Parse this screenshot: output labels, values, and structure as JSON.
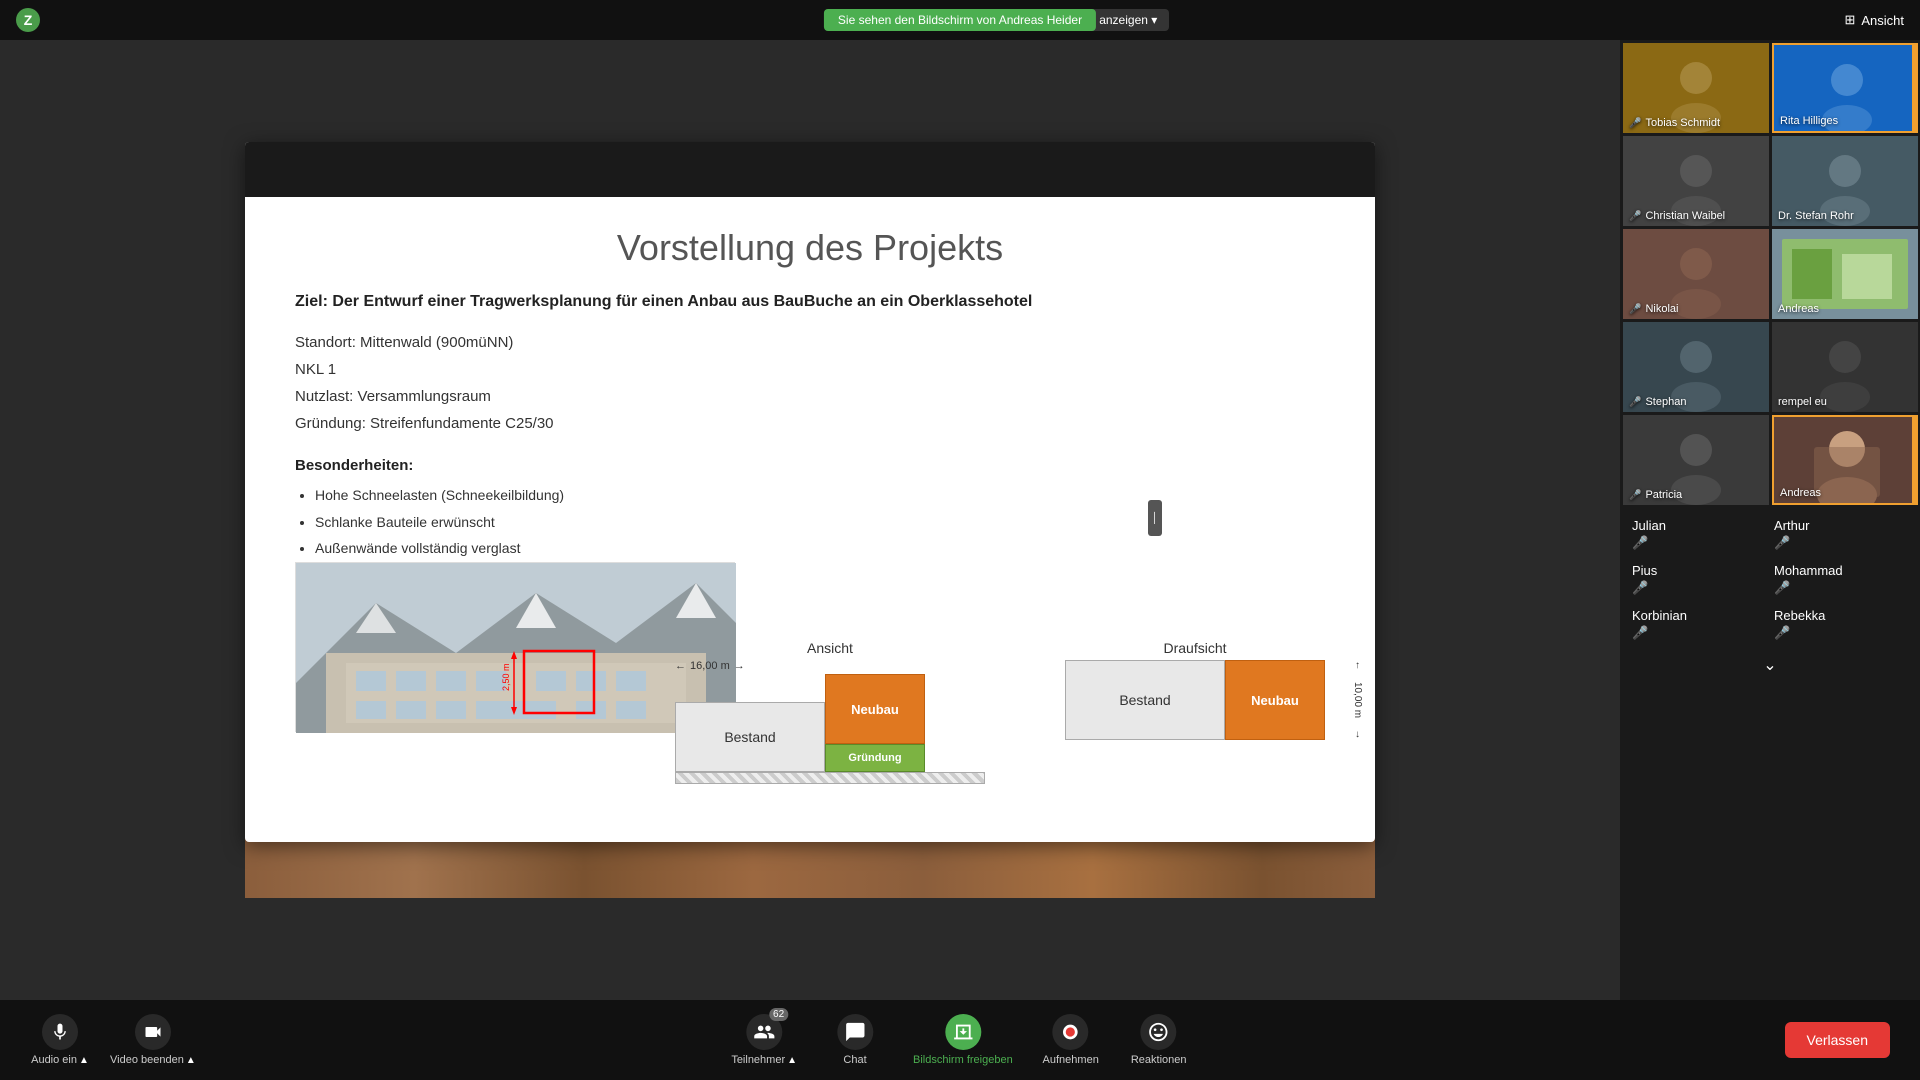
{
  "app": {
    "logo_symbol": "Z",
    "sharing_banner": "Sie sehen den Bildschirm von Andreas Heider",
    "options_btn": "Optionen anzeigen ▾",
    "view_label": "Ansicht",
    "view_icon": "⊞"
  },
  "slide": {
    "title": "Vorstellung des Projekts",
    "ziel": "Ziel: Der Entwurf einer Tragwerksplanung für einen Anbau aus BauBuche an ein Oberklassehotel",
    "details": [
      "Standort: Mittenwald (900müNN)",
      "NKL 1",
      "Nutzlast: Versammlungsraum",
      "Gründung: Streifenfundamente C25/30"
    ],
    "besonderheiten_label": "Besonderheiten:",
    "bullets": [
      "Hohe Schneelasten (Schneekeilbildung)",
      "Schlanke Bauteile erwünscht",
      "Außenwände vollständig verglast"
    ],
    "ansicht_label": "Ansicht",
    "ansicht_measure": "16,00 m",
    "box_bestand": "Bestand",
    "box_neubau": "Neubau",
    "box_grundung": "Gründung",
    "draufsicht_label": "Draufsicht",
    "draufsicht_bestand": "Bestand",
    "draufsicht_neubau": "Neubau",
    "draufsicht_measure": "10,00 m",
    "red_arrow_label": "2,50 m"
  },
  "participants": {
    "video_tiles": [
      {
        "name": "Tobias Schmidt",
        "tile_class": "tile-tobias",
        "mic_off": true
      },
      {
        "name": "Rita Hilliges",
        "tile_class": "tile-rita",
        "mic_off": false,
        "active": true
      },
      {
        "name": "Christian Waibel",
        "tile_class": "tile-christian",
        "mic_off": true
      },
      {
        "name": "Dr. Stefan Rohr",
        "tile_class": "tile-stefan",
        "mic_off": false
      },
      {
        "name": "Nikolai",
        "tile_class": "tile-nikolai",
        "mic_off": true
      },
      {
        "name": "Andreas",
        "tile_class": "tile-andreas1",
        "mic_off": false
      },
      {
        "name": "Stephan",
        "tile_class": "tile-stephan",
        "mic_off": true
      },
      {
        "name": "rempel eu",
        "tile_class": "tile-rempel",
        "mic_off": false
      },
      {
        "name": "Patricia",
        "tile_class": "tile-patricia",
        "mic_off": true
      },
      {
        "name": "Andreas",
        "tile_class": "tile-andreas2",
        "mic_off": false,
        "active": true
      }
    ],
    "audio_only": [
      {
        "name": "Julian",
        "mic_off": true
      },
      {
        "name": "Arthur",
        "mic_off": true
      },
      {
        "name": "Pius",
        "mic_off": true
      },
      {
        "name": "Mohammad",
        "mic_off": true
      },
      {
        "name": "Korbinian",
        "mic_off": true
      },
      {
        "name": "Rebekka",
        "mic_off": true
      }
    ]
  },
  "toolbar": {
    "left": [
      {
        "label": "Audio ein",
        "icon": "🎤",
        "sub_icon": "▲",
        "active": false
      },
      {
        "label": "Video beenden",
        "icon": "📷",
        "sub_icon": "▲",
        "active": false
      }
    ],
    "center": [
      {
        "label": "Teilnehmer",
        "icon": "👥",
        "count": "62",
        "sub_icon": "▲"
      },
      {
        "label": "Chat",
        "icon": "💬",
        "sub_icon": ""
      },
      {
        "label": "Bildschirm freigeben",
        "icon": "⬆",
        "active": true
      },
      {
        "label": "Aufnehmen",
        "icon": "⏺",
        "sub_icon": ""
      },
      {
        "label": "Reaktionen",
        "icon": "😊",
        "sub_icon": ""
      }
    ],
    "end_btn": "Verlassen"
  }
}
